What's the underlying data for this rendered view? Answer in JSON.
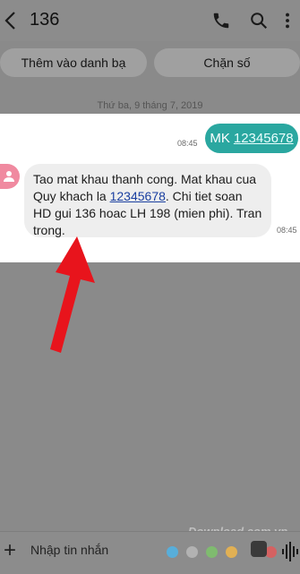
{
  "header": {
    "title": "136",
    "icons": [
      "back-chevron-icon",
      "phone-icon",
      "search-icon",
      "more-vertical-icon"
    ]
  },
  "actions": {
    "add_contact": "Thêm vào danh bạ",
    "block": "Chặn số"
  },
  "conversation": {
    "date": "Thứ ba, 9 tháng 7, 2019",
    "sent": {
      "prefix": "MK",
      "number": "12345678",
      "time": "08:45"
    },
    "received": {
      "text_before": "Tao mat khau thanh cong. Mat khau cua Quy khach la ",
      "link": "12345678",
      "text_after": ". Chi tiet soan HD gui 136 hoac LH 198 (mien phi). Tran trong.",
      "time": "08:45"
    }
  },
  "composer": {
    "placeholder": "Nhập tin nhắn",
    "add_icon": "+"
  },
  "colors": {
    "sent_bubble": "#2aa7a0",
    "arrow": "#e8141c",
    "avatar": "#f08aa0"
  },
  "watermark": "Download.com.vn"
}
